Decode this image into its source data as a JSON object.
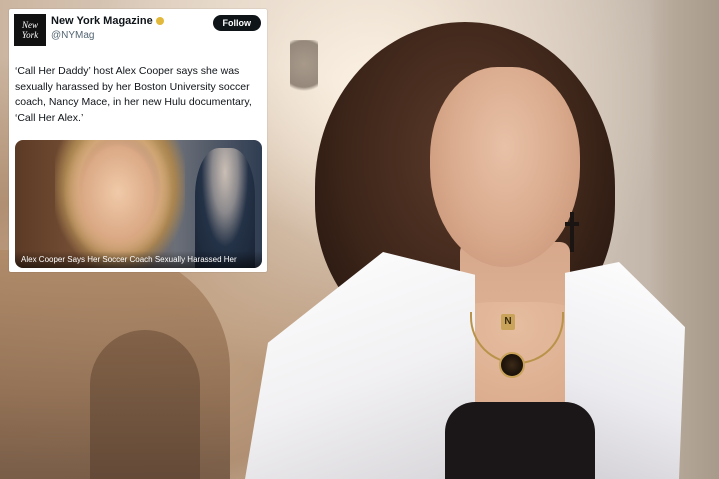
{
  "tweet": {
    "avatar_text": [
      "New",
      "York"
    ],
    "account_name": "New York Magazine",
    "handle": "@NYMag",
    "follow_label": "Follow",
    "text": "‘Call Her Daddy’ host Alex Cooper says she was sexually harassed by her Boston University soccer coach, Nancy Mace, in her new Hulu documentary, ‘Call Her Alex.’",
    "media_caption": "Alex Cooper Says Her Soccer Coach Sexually Harassed Her"
  },
  "photo": {
    "necklace_letter": "N"
  },
  "colors": {
    "blazer": "#f1f0f2",
    "hair": "#3e261a",
    "top": "#1b1719",
    "follow_button": "#0f1419"
  }
}
